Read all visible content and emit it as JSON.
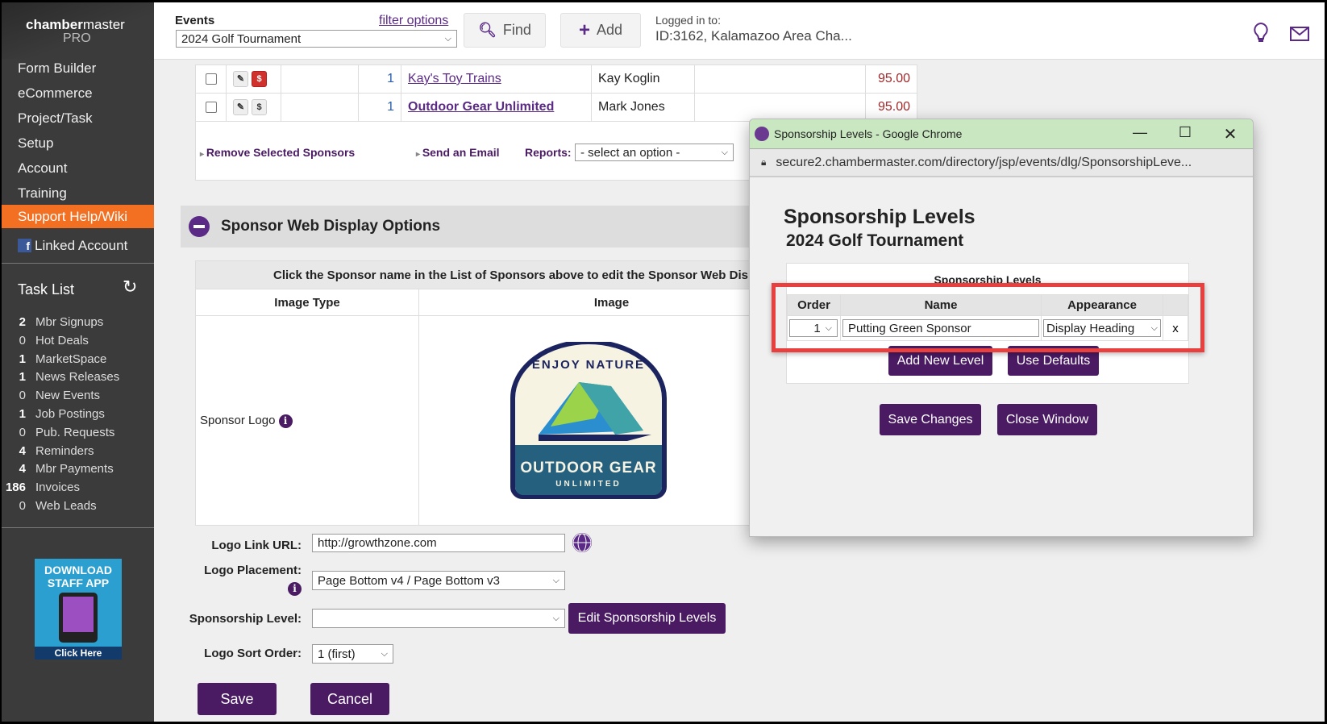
{
  "sidebar": {
    "brand_a": "chamber",
    "brand_b": "master",
    "brand_sub": "PRO",
    "nav": [
      "Form Builder",
      "eCommerce",
      "Project/Task",
      "Setup",
      "Account",
      "Training",
      "Support Help/Wiki"
    ],
    "linked_account": "Linked Account",
    "task_list_title": "Task List",
    "tasks": [
      {
        "count": "2",
        "label": "Mbr Signups",
        "bold": true
      },
      {
        "count": "0",
        "label": "Hot Deals",
        "bold": false
      },
      {
        "count": "1",
        "label": "MarketSpace",
        "bold": true
      },
      {
        "count": "1",
        "label": "News Releases",
        "bold": true
      },
      {
        "count": "0",
        "label": "New Events",
        "bold": false
      },
      {
        "count": "1",
        "label": "Job Postings",
        "bold": true
      },
      {
        "count": "0",
        "label": "Pub. Requests",
        "bold": false
      },
      {
        "count": "4",
        "label": "Reminders",
        "bold": true
      },
      {
        "count": "4",
        "label": "Mbr Payments",
        "bold": true
      },
      {
        "count": "186",
        "label": "Invoices",
        "bold": true
      },
      {
        "count": "0",
        "label": "Web Leads",
        "bold": false
      }
    ],
    "app_promo": {
      "line1": "DOWNLOAD",
      "line2": "STAFF APP",
      "cta": "Click Here"
    }
  },
  "header": {
    "events_label": "Events",
    "filter_options": "filter options",
    "event_selected": "2024 Golf Tournament",
    "find": "Find",
    "add": "Add",
    "logged_in_label": "Logged in to:",
    "logged_in_value": "ID:3162, Kalamazoo Area Cha..."
  },
  "sponsors": [
    {
      "count": "1",
      "name": "Kay's Toy Trains",
      "contact": "Kay Koglin",
      "amount": "95.00",
      "paid": true
    },
    {
      "count": "1",
      "name": "Outdoor Gear Unlimited",
      "contact": "Mark Jones",
      "amount": "95.00",
      "paid": false
    }
  ],
  "actions": {
    "remove": "Remove Selected Sponsors",
    "email": "Send an Email",
    "reports_label": "Reports:",
    "reports_value": "- select an option -"
  },
  "web_display": {
    "title": "Sponsor Web Display Options",
    "instruction": "Click the Sponsor name in the List of Sponsors above to edit the Sponsor Web Dis",
    "col_image_type": "Image Type",
    "col_image": "Image",
    "row_label": "Sponsor Logo",
    "logo_text": {
      "top": "ENJOY NATURE",
      "main": "OUTDOOR GEAR",
      "sub": "UNLIMITED"
    }
  },
  "form": {
    "link_label": "Logo Link URL:",
    "link_value": "http://growthzone.com",
    "placement_label": "Logo Placement:",
    "placement_value": "Page Bottom v4 / Page Bottom v3",
    "level_label": "Sponsorship Level:",
    "level_value": "",
    "edit_levels": "Edit Sponsorship Levels",
    "sort_label": "Logo Sort Order:",
    "sort_value": "1 (first)",
    "save": "Save",
    "cancel": "Cancel"
  },
  "dialog": {
    "window_title": "Sponsorship Levels - Google Chrome",
    "url": "secure2.chambermaster.com/directory/jsp/events/dlg/SponsorshipLeve...",
    "heading": "Sponsorship Levels",
    "subheading": "2024 Golf Tournament",
    "table_caption": "Sponsorship Levels",
    "columns": [
      "Order",
      "Name",
      "Appearance"
    ],
    "rows": [
      {
        "order": "1",
        "name": "Putting Green Sponsor",
        "appearance": "Display Heading",
        "remove": "x"
      }
    ],
    "add_level": "Add New Level",
    "use_defaults": "Use Defaults",
    "save_changes": "Save Changes",
    "close_window": "Close Window"
  },
  "colors": {
    "accent": "#4a1a63",
    "sidebar": "#3b3b3b",
    "active_nav": "#f36f21",
    "dialog_title": "#c9e7c0",
    "highlight": "#e8403f"
  }
}
